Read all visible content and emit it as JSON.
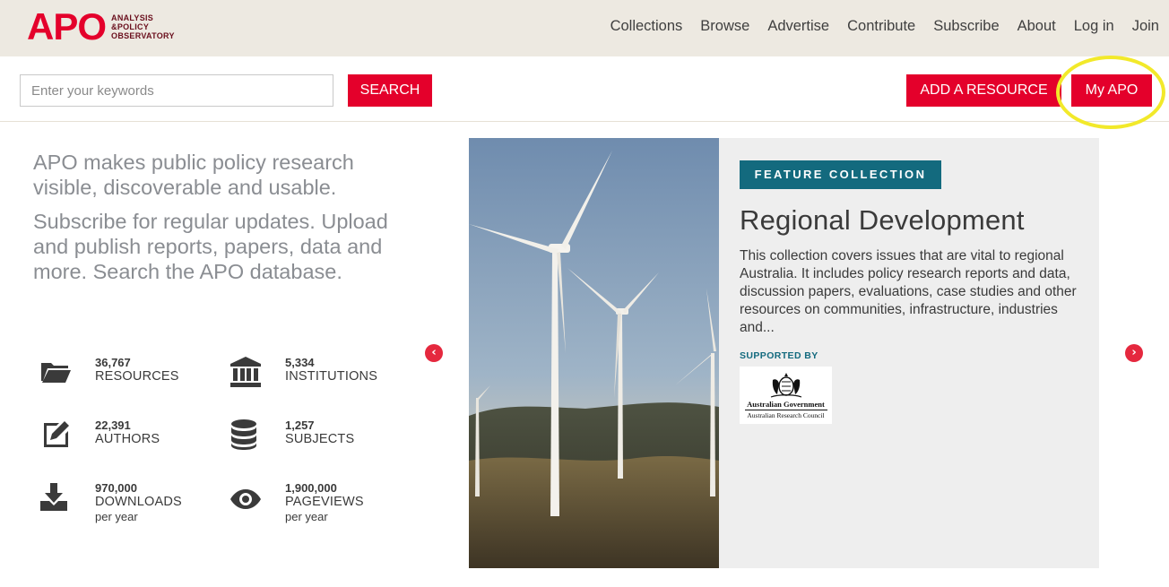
{
  "header": {
    "logo_text": "APO",
    "logo_tagline": [
      "ANALYSIS",
      "&POLICY",
      "OBSERVATORY"
    ],
    "nav": [
      "Collections",
      "Browse",
      "Advertise",
      "Contribute",
      "Subscribe",
      "About",
      "Log in",
      "Join"
    ]
  },
  "search": {
    "placeholder": "Enter your keywords",
    "value": "",
    "button_label": "SEARCH"
  },
  "actions": {
    "add_resource_label": "ADD A RESOURCE",
    "my_apo_label": "My APO"
  },
  "intro": {
    "line1": "APO makes public policy research visible, discoverable and usable.",
    "line2": "Subscribe for regular updates. Upload and publish reports, papers, data and more. Search the APO database."
  },
  "stats": [
    {
      "icon": "folder-icon",
      "number": "36,767",
      "label": "RESOURCES",
      "sub": ""
    },
    {
      "icon": "institution-icon",
      "number": "5,334",
      "label": "INSTITUTIONS",
      "sub": ""
    },
    {
      "icon": "edit-icon",
      "number": "22,391",
      "label": "AUTHORS",
      "sub": ""
    },
    {
      "icon": "database-icon",
      "number": "1,257",
      "label": "SUBJECTS",
      "sub": ""
    },
    {
      "icon": "download-icon",
      "number": "970,000",
      "label": "DOWNLOADS",
      "sub": "per year"
    },
    {
      "icon": "eye-icon",
      "number": "1,900,000",
      "label": "PAGEVIEWS",
      "sub": "per year"
    }
  ],
  "feature": {
    "badge": "FEATURE COLLECTION",
    "title": "Regional Development",
    "description": "This collection covers issues that are vital to regional Australia. It includes policy research reports and data, discussion papers, evaluations, case studies and other resources on communities, infrastructure, industries and...",
    "supported_by": "SUPPORTED BY",
    "sponsor_line1": "Australian Government",
    "sponsor_line2": "Australian Research Council"
  },
  "colors": {
    "brand_red": "#e4002b",
    "logo_maroon": "#6a0f1d",
    "badge_teal": "#136a7e",
    "header_bg": "#ede9e1",
    "highlight_yellow": "#f2e92a"
  }
}
